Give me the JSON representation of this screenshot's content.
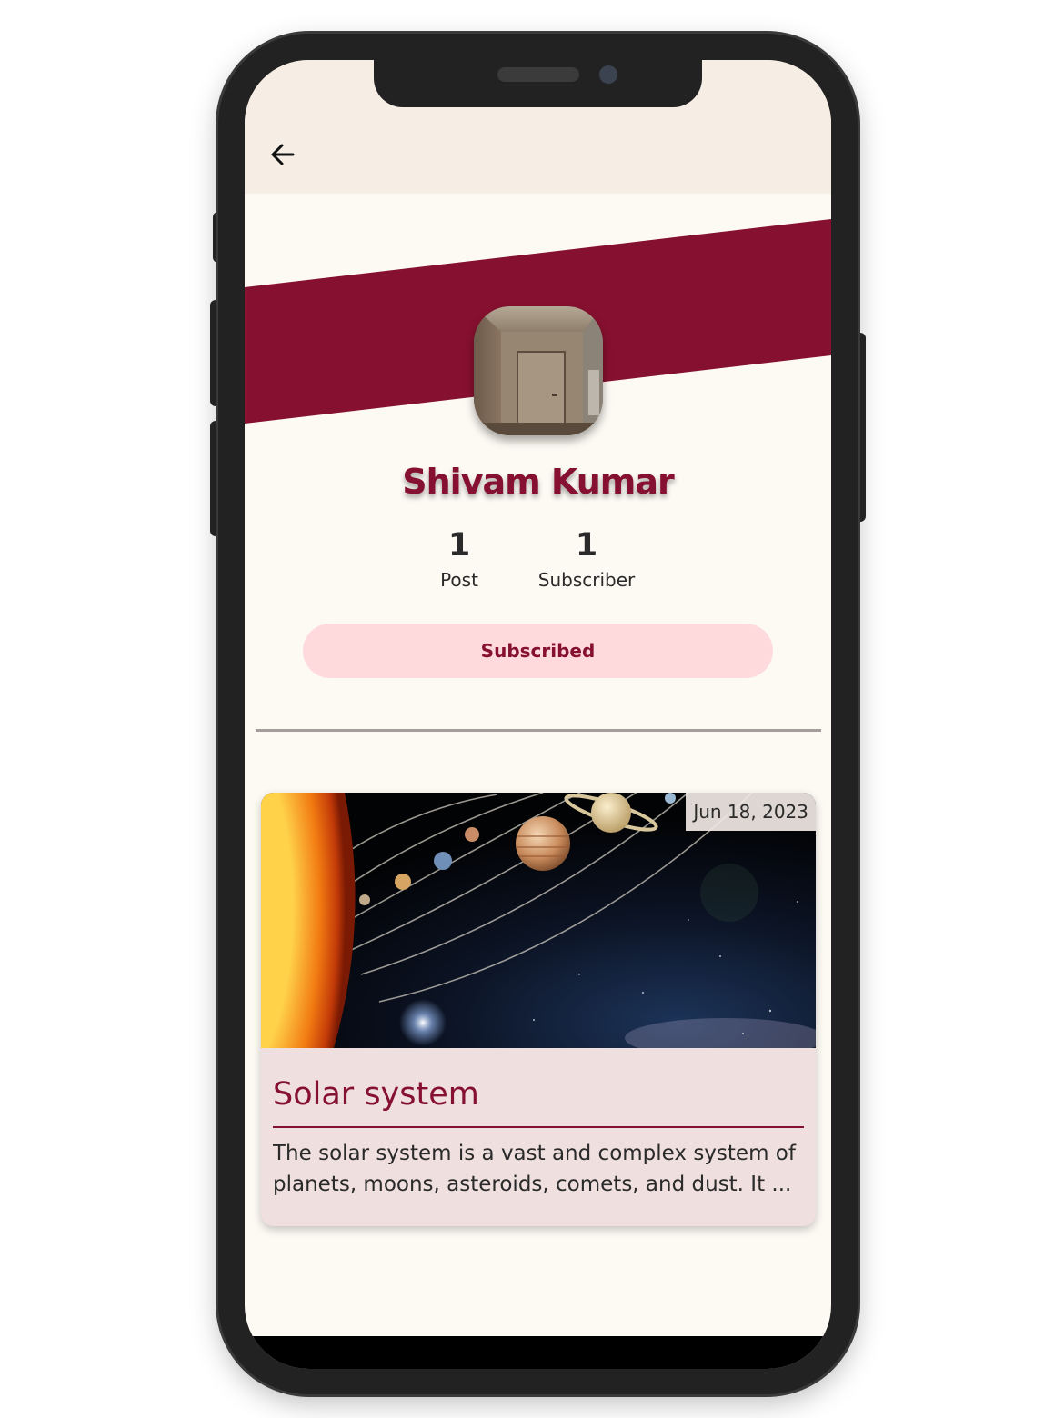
{
  "colors": {
    "brand": "#86102f",
    "appbar_bg": "#f6ede4",
    "page_bg": "#fdf9f3",
    "button_bg": "#ffdadc",
    "card_bg": "#efdfdf"
  },
  "appbar": {
    "back_icon": "arrow-left-icon"
  },
  "profile": {
    "name": "Shivam Kumar",
    "stats": [
      {
        "value": "1",
        "label": "Post"
      },
      {
        "value": "1",
        "label": "Subscriber"
      }
    ],
    "subscribe_label": "Subscribed"
  },
  "posts": [
    {
      "date": "Jun 18, 2023",
      "title": "Solar system",
      "excerpt": "The solar system is a vast and complex system of planets, moons, asteroids, comets, and dust. It ..."
    }
  ]
}
